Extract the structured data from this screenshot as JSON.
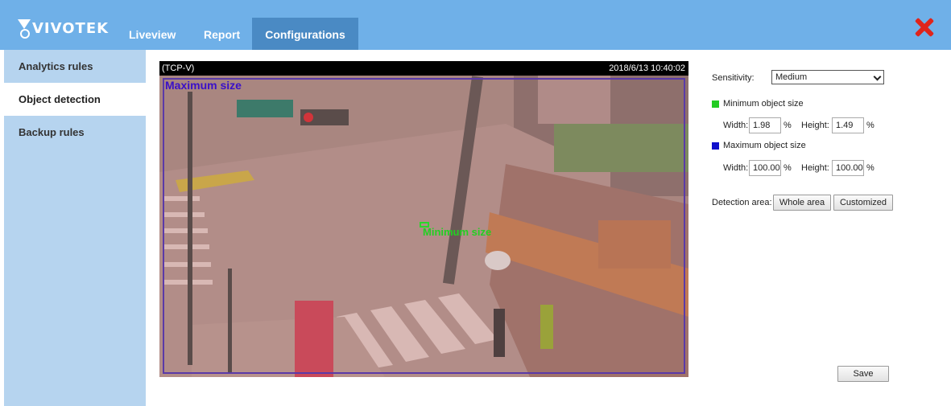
{
  "brand": {
    "name": "VIVOTEK"
  },
  "nav": {
    "tabs": [
      "Liveview",
      "Report",
      "Configurations"
    ],
    "active": "Configurations"
  },
  "sidebar": {
    "items": [
      {
        "label": "Analytics rules"
      },
      {
        "label": "Object detection"
      },
      {
        "label": "Backup rules"
      }
    ],
    "active": "Object detection"
  },
  "video": {
    "protocol": "(TCP-V)",
    "timestamp": "2018/6/13 10:40:02",
    "max_label": "Maximum size",
    "min_label": "Minimum size"
  },
  "settings": {
    "sensitivity_label": "Sensitivity:",
    "sensitivity_value": "Medium",
    "min_title": "Minimum object size",
    "max_title": "Maximum object size",
    "width_label": "Width:",
    "height_label": "Height:",
    "percent": "%",
    "min_width": "1.98",
    "min_height": "1.49",
    "max_width": "100.00",
    "max_height": "100.00",
    "detection_area_label": "Detection area:",
    "whole_area": "Whole area",
    "customized": "Customized",
    "save": "Save"
  },
  "colors": {
    "header": "#6fb0e8",
    "active_tab": "#4a8ac4",
    "sidebar": "#b6d4ef",
    "min_swatch": "#22cc22",
    "max_swatch": "#1010cc",
    "close": "#e0241b"
  },
  "icons": {
    "close": "close-icon",
    "dropdown": "chevron-down-icon",
    "logo": "vivotek-logo-icon"
  }
}
